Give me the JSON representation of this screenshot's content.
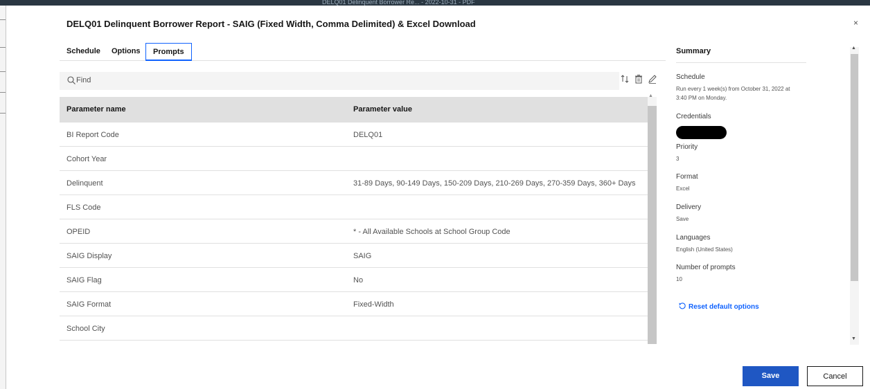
{
  "background_app": {
    "title_ghost": "DELQ01 Delinquent Borrower Re... - 2022-10-31 - PDF"
  },
  "dialog": {
    "title": "DELQ01 Delinquent Borrower Report - SAIG (Fixed Width, Comma Delimited) & Excel Download",
    "close_glyph": "×"
  },
  "tabs": [
    {
      "label": "Schedule",
      "active": false
    },
    {
      "label": "Options",
      "active": false
    },
    {
      "label": "Prompts",
      "active": true
    }
  ],
  "find": {
    "placeholder": "Find",
    "icon": "search-icon"
  },
  "toolbar_icons": [
    "sort-icon",
    "trash-icon",
    "edit-icon"
  ],
  "table": {
    "headers": [
      "Parameter name",
      "Parameter value"
    ],
    "rows": [
      [
        "BI Report Code",
        "DELQ01"
      ],
      [
        "Cohort Year",
        ""
      ],
      [
        "Delinquent",
        "31-89 Days, 90-149 Days, 150-209 Days, 210-269 Days, 270-359 Days, 360+ Days"
      ],
      [
        "FLS Code",
        ""
      ],
      [
        "OPEID",
        "* - All Available Schools at School Group Code"
      ],
      [
        "SAIG Display",
        "SAIG"
      ],
      [
        "SAIG Flag",
        "No"
      ],
      [
        "SAIG Format",
        "Fixed-Width"
      ],
      [
        "School City",
        ""
      ]
    ]
  },
  "summary": {
    "title": "Summary",
    "schedule_label": "Schedule",
    "schedule_value": "Run every 1 week(s) from October 31, 2022 at 3:40 PM on Monday.",
    "credentials_label": "Credentials",
    "priority_label": "Priority",
    "priority_value": "3",
    "format_label": "Format",
    "format_value": "Excel",
    "delivery_label": "Delivery",
    "delivery_value": "Save",
    "languages_label": "Languages",
    "languages_value": "English (United States)",
    "prompts_label": "Number of prompts",
    "prompts_value": "10",
    "reset_label": "Reset default options"
  },
  "buttons": {
    "save": "Save",
    "cancel": "Cancel"
  },
  "colors": {
    "accent": "#0f62fe",
    "primary_button": "#1f57c3",
    "header_bg": "#e0e0e0"
  }
}
